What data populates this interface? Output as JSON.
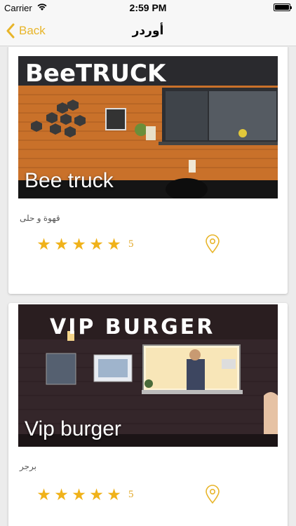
{
  "status_bar": {
    "carrier": "Carrier",
    "time": "2:59 PM"
  },
  "nav": {
    "back_label": "Back",
    "title": "أوردر"
  },
  "accent_color": "#e8b52a",
  "restaurants": [
    {
      "name": "Bee truck",
      "category": "قهوة و حلى",
      "rating": "5",
      "sign_text": "BeeTRUCK"
    },
    {
      "name": "Vip burger",
      "category": "برجر",
      "rating": "5",
      "sign_text": "VIP BURGER"
    }
  ]
}
